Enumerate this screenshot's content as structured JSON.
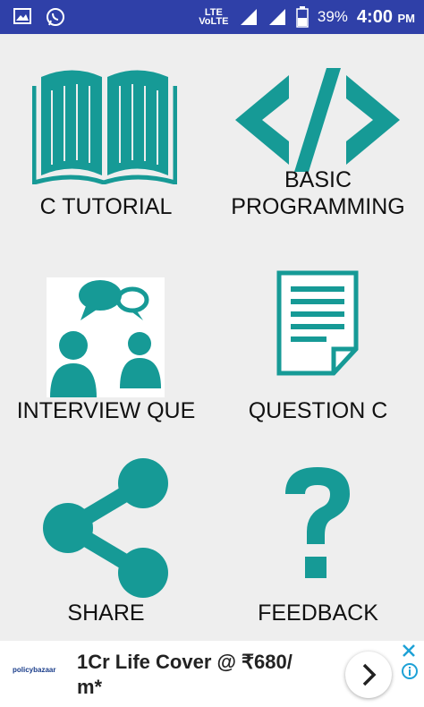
{
  "status_bar": {
    "network_label": "VoLTE",
    "lte_label": "LTE",
    "battery_percent": "39%",
    "time": "4:00",
    "ampm": "PM"
  },
  "menu": {
    "items": [
      {
        "label": "C TUTORIAL",
        "icon": "book-icon"
      },
      {
        "label_line1": "BASIC",
        "label_line2": "PROGRAMMING",
        "icon": "code-icon"
      },
      {
        "label": "INTERVIEW QUE",
        "icon": "people-chat-icon"
      },
      {
        "label": "QUESTION C",
        "icon": "document-icon"
      },
      {
        "label": "SHARE",
        "icon": "share-icon"
      },
      {
        "label": "FEEDBACK",
        "icon": "question-mark-icon"
      }
    ],
    "icon_color": "#169a96"
  },
  "ad": {
    "text": "1Cr Life Cover @ ₹680/ m*",
    "logo_text": "policybazaar"
  }
}
